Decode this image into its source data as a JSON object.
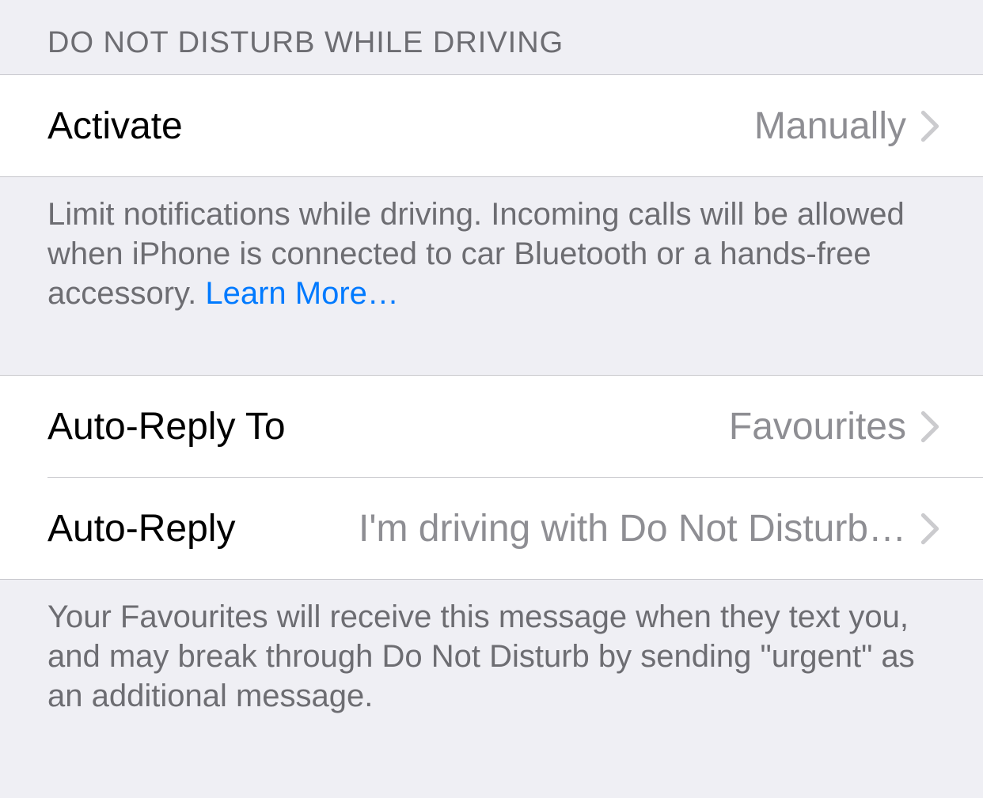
{
  "section1": {
    "header": "Do Not Disturb While Driving",
    "activate": {
      "label": "Activate",
      "value": "Manually"
    },
    "footer_text": "Limit notifications while driving. Incoming calls will be allowed when iPhone is connected to car Bluetooth or a hands-free accessory. ",
    "learn_more": "Learn More…"
  },
  "section2": {
    "auto_reply_to": {
      "label": "Auto-Reply To",
      "value": "Favourites"
    },
    "auto_reply": {
      "label": "Auto-Reply",
      "value": "I'm driving with Do Not Disturb…"
    },
    "footer_text": "Your Favourites will receive this message when they text you, and may break through Do Not Disturb by sending \"urgent\" as an additional message."
  }
}
